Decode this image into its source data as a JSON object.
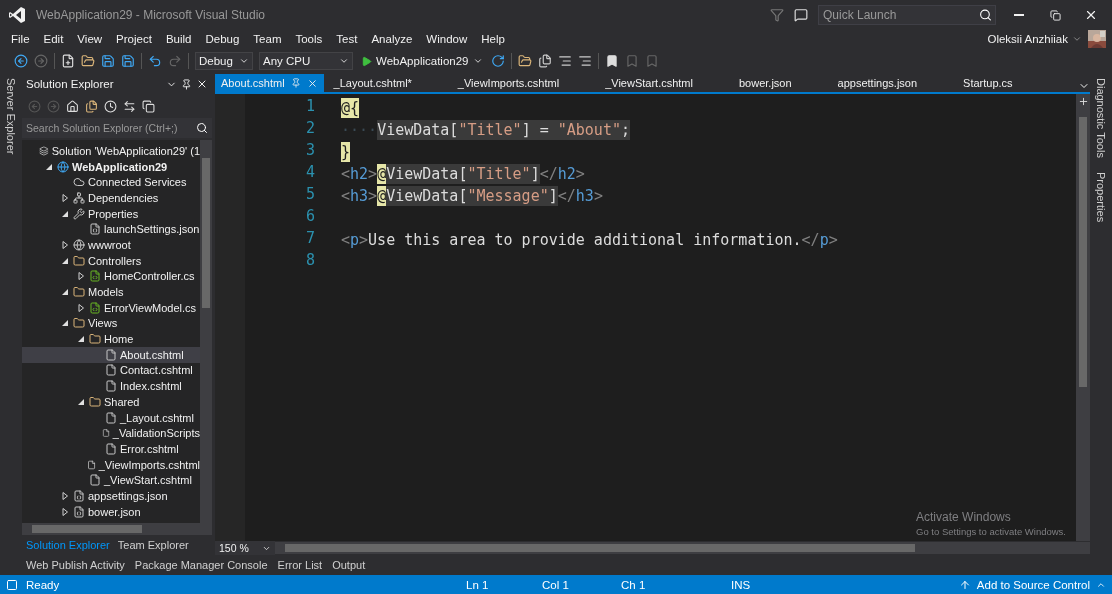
{
  "window": {
    "title": "WebApplication29 - Microsoft Visual Studio"
  },
  "quick_launch": {
    "placeholder": "Quick Launch"
  },
  "menu": [
    "File",
    "Edit",
    "View",
    "Project",
    "Build",
    "Debug",
    "Team",
    "Tools",
    "Test",
    "Analyze",
    "Window",
    "Help"
  ],
  "user": {
    "name": "Oleksii Anzhiiak"
  },
  "toolbar": {
    "configuration": "Debug",
    "platform": "Any CPU",
    "start_target": "WebApplication29"
  },
  "left_strip": [
    "Server Explorer"
  ],
  "right_strip": [
    "Diagnostic Tools",
    "Properties"
  ],
  "solution_explorer": {
    "title": "Solution Explorer",
    "search": {
      "placeholder": "Search Solution Explorer (Ctrl+;)"
    },
    "tree": [
      {
        "label": "Solution 'WebApplication29' (1",
        "kind": "solution",
        "selected": false,
        "children": [
          {
            "label": "WebApplication29",
            "kind": "project",
            "bold": true,
            "expanded": true,
            "selected": false,
            "children": [
              {
                "label": "Connected Services",
                "kind": "cloud",
                "selected": false
              },
              {
                "label": "Dependencies",
                "kind": "dependencies",
                "expanded": false,
                "selected": false
              },
              {
                "label": "Properties",
                "kind": "wrench",
                "expanded": true,
                "selected": false,
                "children": [
                  {
                    "label": "launchSettings.json",
                    "kind": "json",
                    "selected": false
                  }
                ]
              },
              {
                "label": "wwwroot",
                "kind": "globe",
                "expanded": false,
                "selected": false
              },
              {
                "label": "Controllers",
                "kind": "folder",
                "expanded": true,
                "selected": false,
                "children": [
                  {
                    "label": "HomeController.cs",
                    "kind": "csharp",
                    "expanded": false,
                    "selected": false
                  }
                ]
              },
              {
                "label": "Models",
                "kind": "folder",
                "expanded": true,
                "selected": false,
                "children": [
                  {
                    "label": "ErrorViewModel.cs",
                    "kind": "csharp",
                    "expanded": false,
                    "selected": false
                  }
                ]
              },
              {
                "label": "Views",
                "kind": "folder",
                "expanded": true,
                "selected": false,
                "children": [
                  {
                    "label": "Home",
                    "kind": "folder",
                    "expanded": true,
                    "selected": false,
                    "children": [
                      {
                        "label": "About.cshtml",
                        "kind": "razor",
                        "selected": true
                      },
                      {
                        "label": "Contact.cshtml",
                        "kind": "razor",
                        "selected": false
                      },
                      {
                        "label": "Index.cshtml",
                        "kind": "razor",
                        "selected": false
                      }
                    ]
                  },
                  {
                    "label": "Shared",
                    "kind": "folder",
                    "expanded": true,
                    "selected": false,
                    "children": [
                      {
                        "label": "_Layout.cshtml",
                        "kind": "razor",
                        "selected": false
                      },
                      {
                        "label": "_ValidationScripts",
                        "kind": "razor",
                        "selected": false
                      },
                      {
                        "label": "Error.cshtml",
                        "kind": "razor",
                        "selected": false
                      }
                    ]
                  },
                  {
                    "label": "_ViewImports.cshtml",
                    "kind": "razor",
                    "selected": false
                  },
                  {
                    "label": "_ViewStart.cshtml",
                    "kind": "razor",
                    "selected": false
                  }
                ]
              },
              {
                "label": "appsettings.json",
                "kind": "json",
                "expanded": false,
                "selected": false
              },
              {
                "label": "bower.json",
                "kind": "json",
                "expanded": false,
                "selected": false
              }
            ]
          }
        ]
      }
    ],
    "panel_tabs": [
      {
        "label": "Solution Explorer",
        "selected": true
      },
      {
        "label": "Team Explorer",
        "selected": false
      }
    ]
  },
  "editor_tabs": [
    {
      "label": "About.cshtml",
      "selected": true
    },
    {
      "label": "_Layout.cshtml*",
      "selected": false
    },
    {
      "label": "_ViewImports.cshtml",
      "selected": false
    },
    {
      "label": "_ViewStart.cshtml",
      "selected": false
    },
    {
      "label": "bower.json",
      "selected": false
    },
    {
      "label": "appsettings.json",
      "selected": false
    },
    {
      "label": "Startup.cs",
      "selected": false
    }
  ],
  "code_lines": [
    {
      "number": "1",
      "tokens": [
        {
          "text": "@{",
          "kind": "razor"
        }
      ]
    },
    {
      "number": "2",
      "tokens": [
        {
          "text": "····",
          "kind": "whitespace",
          "shaded": false
        },
        {
          "text": "ViewData[",
          "kind": "code",
          "shaded": true
        },
        {
          "text": "\"Title\"",
          "kind": "string",
          "shaded": true
        },
        {
          "text": "] = ",
          "kind": "code",
          "shaded": true
        },
        {
          "text": "\"About\"",
          "kind": "string",
          "shaded": true
        },
        {
          "text": ";",
          "kind": "code",
          "shaded": true
        }
      ]
    },
    {
      "number": "3",
      "tokens": [
        {
          "text": "}",
          "kind": "razor"
        }
      ]
    },
    {
      "number": "4",
      "tokens": [
        {
          "text": "<",
          "kind": "punct",
          "shaded": false
        },
        {
          "text": "h2",
          "kind": "tag",
          "shaded": false
        },
        {
          "text": ">",
          "kind": "punct",
          "shaded": false
        },
        {
          "text": "@",
          "kind": "razor"
        },
        {
          "text": "ViewData[",
          "kind": "code",
          "shaded": true
        },
        {
          "text": "\"Title\"",
          "kind": "string",
          "shaded": true
        },
        {
          "text": "]",
          "kind": "code",
          "shaded": true
        },
        {
          "text": "</",
          "kind": "punct",
          "shaded": false
        },
        {
          "text": "h2",
          "kind": "tag",
          "shaded": false
        },
        {
          "text": ">",
          "kind": "punct",
          "shaded": false
        }
      ]
    },
    {
      "number": "5",
      "tokens": [
        {
          "text": "<",
          "kind": "punct",
          "shaded": false
        },
        {
          "text": "h3",
          "kind": "tag",
          "shaded": false
        },
        {
          "text": ">",
          "kind": "punct",
          "shaded": false
        },
        {
          "text": "@",
          "kind": "razor"
        },
        {
          "text": "ViewData[",
          "kind": "code",
          "shaded": true
        },
        {
          "text": "\"Message\"",
          "kind": "string",
          "shaded": true
        },
        {
          "text": "]",
          "kind": "code",
          "shaded": true
        },
        {
          "text": "</",
          "kind": "punct",
          "shaded": false
        },
        {
          "text": "h3",
          "kind": "tag",
          "shaded": false
        },
        {
          "text": ">",
          "kind": "punct",
          "shaded": false
        }
      ]
    },
    {
      "number": "6"
    },
    {
      "number": "7",
      "tokens": [
        {
          "text": "<",
          "kind": "punct",
          "shaded": false
        },
        {
          "text": "p",
          "kind": "tag",
          "shaded": false
        },
        {
          "text": ">",
          "kind": "punct",
          "shaded": false
        },
        {
          "text": "Use this area to provide additional information.",
          "kind": "code",
          "shaded": false
        },
        {
          "text": "</",
          "kind": "punct",
          "shaded": false
        },
        {
          "text": "p",
          "kind": "tag",
          "shaded": false
        },
        {
          "text": ">",
          "kind": "punct",
          "shaded": false
        }
      ]
    },
    {
      "number": "8"
    }
  ],
  "zoom": "150 %",
  "activation_notice": {
    "title": "Activate Windows",
    "text": "Go to Settings to activate Windows."
  },
  "tool_tabs": [
    "Web Publish Activity",
    "Package Manager Console",
    "Error List",
    "Output"
  ],
  "status_bar": {
    "state": "Ready",
    "line": "Ln 1",
    "column": "Col 1",
    "char": "Ch 1",
    "mode": "INS",
    "source_control": "Add to Source Control"
  }
}
